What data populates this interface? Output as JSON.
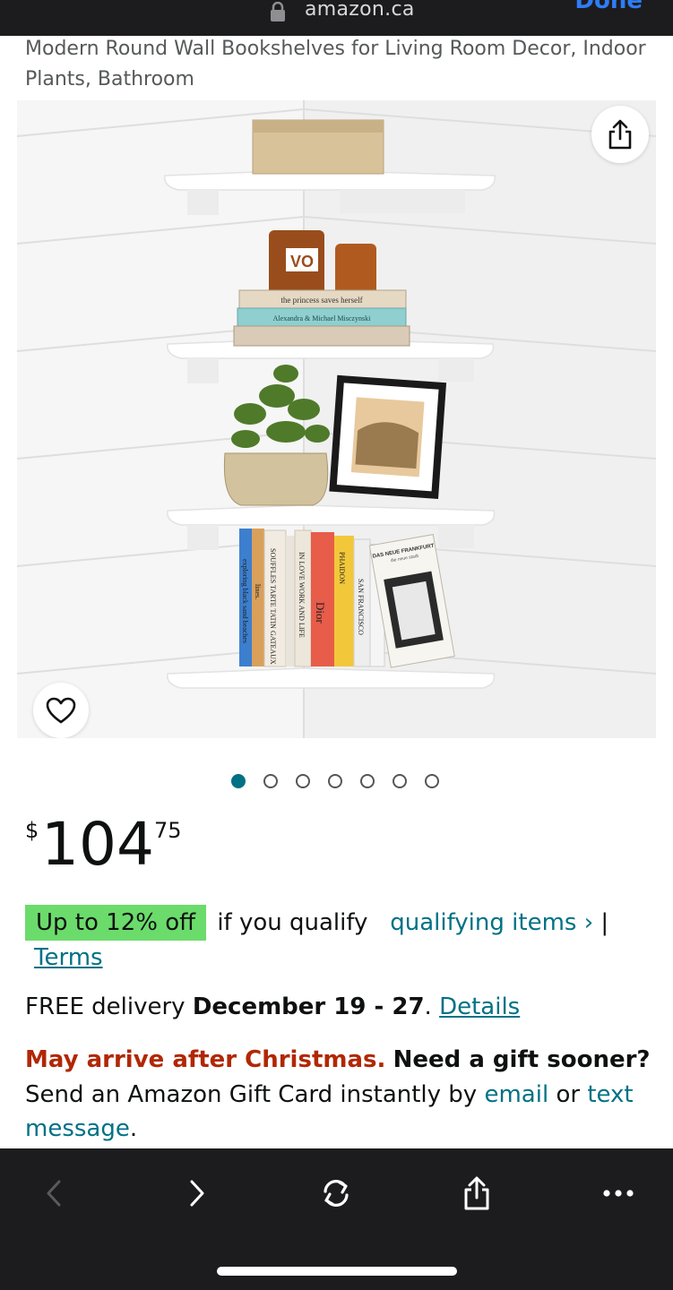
{
  "browser": {
    "domain": "amazon.ca",
    "done_label": "Done"
  },
  "product": {
    "title": "Modern Round Wall Bookshelves for Living Room Decor, Indoor Plants, Bathroom"
  },
  "gallery": {
    "image_count": 7,
    "active_index": 0,
    "candle_label": "VO",
    "book_top_1": "the princess saves herself",
    "book_top_2": "Alexandra & Michael Misczynski",
    "book_spines": [
      "exploring black sand beaches",
      "lines.",
      "SOUFFLES TARTE TATIN GATEAUX",
      "IN LOVE WORK AND LIFE",
      "Dior",
      "PHAIDON",
      "SAN FRANCISCO"
    ],
    "book_cover_title": "DAS NEUE FRANKFURT",
    "book_cover_sub": "die neue stadt"
  },
  "price": {
    "symbol": "$",
    "whole": "104",
    "fraction": "75"
  },
  "promo": {
    "badge": "Up to 12% off",
    "qualify_text": "if you qualify",
    "qualifying_link": "qualifying items ›",
    "separator": "|",
    "terms_link": "Terms"
  },
  "delivery": {
    "prefix": "FREE delivery",
    "dates": "December 19 - 27",
    "period": ".",
    "details_link": "Details"
  },
  "gift": {
    "warning": "May arrive after Christmas.",
    "question": "Need a gift sooner?",
    "line2_prefix": "Send an Amazon Gift Card instantly by",
    "email_link": "email",
    "or": "or",
    "text_link": "text message",
    "end": "."
  },
  "colors": {
    "link": "#007185",
    "deal_green": "#6bdb6b",
    "warning_red": "#b12704",
    "toolbar_bg": "#1c1c1e"
  },
  "icons": [
    "lock-icon",
    "share-icon",
    "heart-icon",
    "back-icon",
    "forward-icon",
    "reload-icon",
    "share-icon",
    "more-icon"
  ]
}
